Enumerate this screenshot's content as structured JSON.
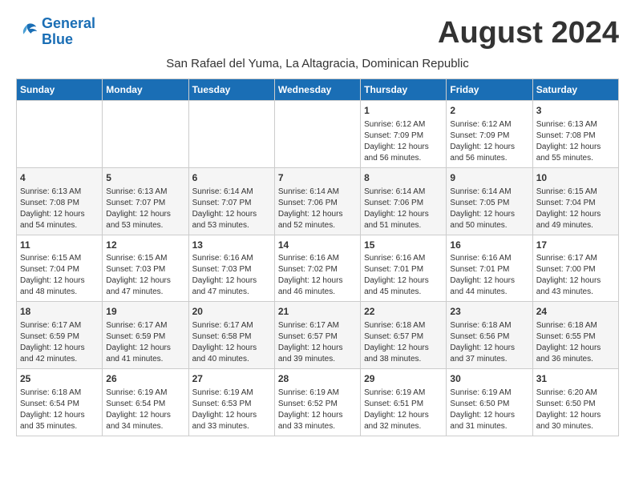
{
  "header": {
    "logo_line1": "General",
    "logo_line2": "Blue",
    "month_year": "August 2024",
    "subtitle": "San Rafael del Yuma, La Altagracia, Dominican Republic"
  },
  "days_of_week": [
    "Sunday",
    "Monday",
    "Tuesday",
    "Wednesday",
    "Thursday",
    "Friday",
    "Saturday"
  ],
  "weeks": [
    [
      {
        "day": "",
        "info": ""
      },
      {
        "day": "",
        "info": ""
      },
      {
        "day": "",
        "info": ""
      },
      {
        "day": "",
        "info": ""
      },
      {
        "day": "1",
        "info": "Sunrise: 6:12 AM\nSunset: 7:09 PM\nDaylight: 12 hours\nand 56 minutes."
      },
      {
        "day": "2",
        "info": "Sunrise: 6:12 AM\nSunset: 7:09 PM\nDaylight: 12 hours\nand 56 minutes."
      },
      {
        "day": "3",
        "info": "Sunrise: 6:13 AM\nSunset: 7:08 PM\nDaylight: 12 hours\nand 55 minutes."
      }
    ],
    [
      {
        "day": "4",
        "info": "Sunrise: 6:13 AM\nSunset: 7:08 PM\nDaylight: 12 hours\nand 54 minutes."
      },
      {
        "day": "5",
        "info": "Sunrise: 6:13 AM\nSunset: 7:07 PM\nDaylight: 12 hours\nand 53 minutes."
      },
      {
        "day": "6",
        "info": "Sunrise: 6:14 AM\nSunset: 7:07 PM\nDaylight: 12 hours\nand 53 minutes."
      },
      {
        "day": "7",
        "info": "Sunrise: 6:14 AM\nSunset: 7:06 PM\nDaylight: 12 hours\nand 52 minutes."
      },
      {
        "day": "8",
        "info": "Sunrise: 6:14 AM\nSunset: 7:06 PM\nDaylight: 12 hours\nand 51 minutes."
      },
      {
        "day": "9",
        "info": "Sunrise: 6:14 AM\nSunset: 7:05 PM\nDaylight: 12 hours\nand 50 minutes."
      },
      {
        "day": "10",
        "info": "Sunrise: 6:15 AM\nSunset: 7:04 PM\nDaylight: 12 hours\nand 49 minutes."
      }
    ],
    [
      {
        "day": "11",
        "info": "Sunrise: 6:15 AM\nSunset: 7:04 PM\nDaylight: 12 hours\nand 48 minutes."
      },
      {
        "day": "12",
        "info": "Sunrise: 6:15 AM\nSunset: 7:03 PM\nDaylight: 12 hours\nand 47 minutes."
      },
      {
        "day": "13",
        "info": "Sunrise: 6:16 AM\nSunset: 7:03 PM\nDaylight: 12 hours\nand 47 minutes."
      },
      {
        "day": "14",
        "info": "Sunrise: 6:16 AM\nSunset: 7:02 PM\nDaylight: 12 hours\nand 46 minutes."
      },
      {
        "day": "15",
        "info": "Sunrise: 6:16 AM\nSunset: 7:01 PM\nDaylight: 12 hours\nand 45 minutes."
      },
      {
        "day": "16",
        "info": "Sunrise: 6:16 AM\nSunset: 7:01 PM\nDaylight: 12 hours\nand 44 minutes."
      },
      {
        "day": "17",
        "info": "Sunrise: 6:17 AM\nSunset: 7:00 PM\nDaylight: 12 hours\nand 43 minutes."
      }
    ],
    [
      {
        "day": "18",
        "info": "Sunrise: 6:17 AM\nSunset: 6:59 PM\nDaylight: 12 hours\nand 42 minutes."
      },
      {
        "day": "19",
        "info": "Sunrise: 6:17 AM\nSunset: 6:59 PM\nDaylight: 12 hours\nand 41 minutes."
      },
      {
        "day": "20",
        "info": "Sunrise: 6:17 AM\nSunset: 6:58 PM\nDaylight: 12 hours\nand 40 minutes."
      },
      {
        "day": "21",
        "info": "Sunrise: 6:17 AM\nSunset: 6:57 PM\nDaylight: 12 hours\nand 39 minutes."
      },
      {
        "day": "22",
        "info": "Sunrise: 6:18 AM\nSunset: 6:57 PM\nDaylight: 12 hours\nand 38 minutes."
      },
      {
        "day": "23",
        "info": "Sunrise: 6:18 AM\nSunset: 6:56 PM\nDaylight: 12 hours\nand 37 minutes."
      },
      {
        "day": "24",
        "info": "Sunrise: 6:18 AM\nSunset: 6:55 PM\nDaylight: 12 hours\nand 36 minutes."
      }
    ],
    [
      {
        "day": "25",
        "info": "Sunrise: 6:18 AM\nSunset: 6:54 PM\nDaylight: 12 hours\nand 35 minutes."
      },
      {
        "day": "26",
        "info": "Sunrise: 6:19 AM\nSunset: 6:54 PM\nDaylight: 12 hours\nand 34 minutes."
      },
      {
        "day": "27",
        "info": "Sunrise: 6:19 AM\nSunset: 6:53 PM\nDaylight: 12 hours\nand 33 minutes."
      },
      {
        "day": "28",
        "info": "Sunrise: 6:19 AM\nSunset: 6:52 PM\nDaylight: 12 hours\nand 33 minutes."
      },
      {
        "day": "29",
        "info": "Sunrise: 6:19 AM\nSunset: 6:51 PM\nDaylight: 12 hours\nand 32 minutes."
      },
      {
        "day": "30",
        "info": "Sunrise: 6:19 AM\nSunset: 6:50 PM\nDaylight: 12 hours\nand 31 minutes."
      },
      {
        "day": "31",
        "info": "Sunrise: 6:20 AM\nSunset: 6:50 PM\nDaylight: 12 hours\nand 30 minutes."
      }
    ]
  ]
}
